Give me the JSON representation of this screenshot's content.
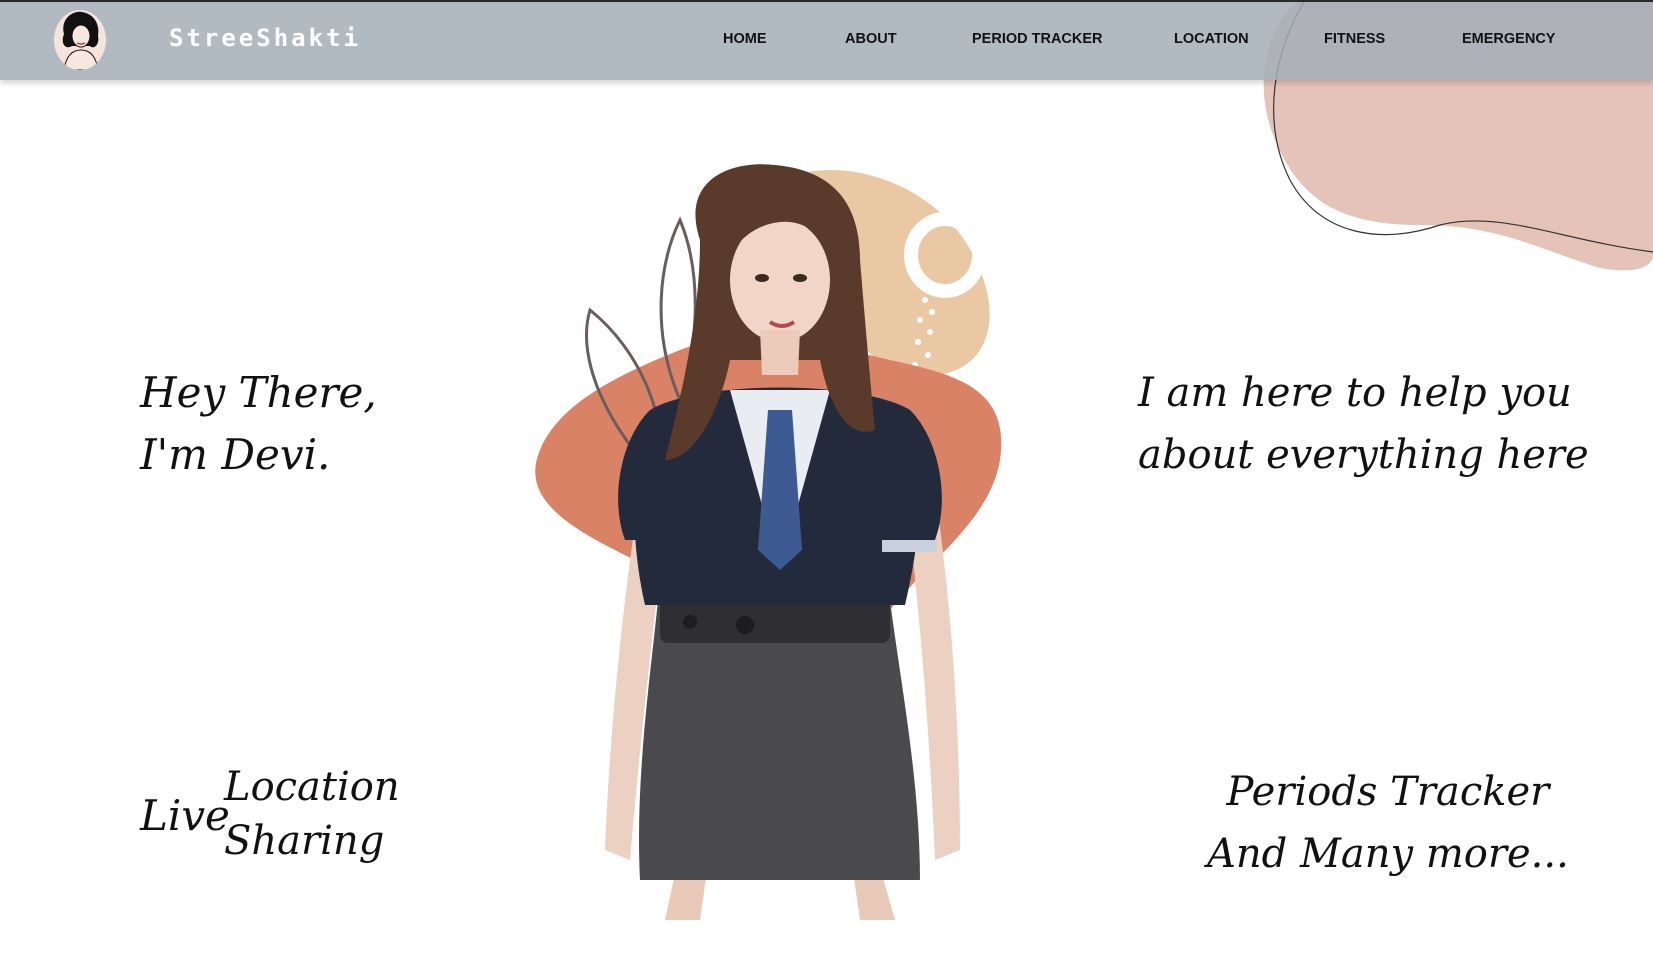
{
  "brand": {
    "name": "StreeShakti",
    "logo_icon": "woman-avatar-icon"
  },
  "nav": {
    "items": [
      {
        "label": "HOME"
      },
      {
        "label": "ABOUT"
      },
      {
        "label": "PERIOD TRACKER"
      },
      {
        "label": "LOCATION"
      },
      {
        "label": "FITNESS"
      },
      {
        "label": "EMERGENCY"
      }
    ]
  },
  "hero": {
    "greeting_line1": "Hey There,",
    "greeting_line2": "I'm Devi.",
    "help_line1": "I am here to help you",
    "help_line2": "about everything here",
    "feature_live": "Live",
    "feature_location_line1": "Location",
    "feature_location_line2": "Sharing",
    "feature_periods_line1": "Periods Tracker",
    "feature_periods_line2": "And Many more..."
  },
  "colors": {
    "navbar": "#a5aeb6",
    "blob_pink": "#e5c3b8",
    "blob_terracotta": "#d98266",
    "blob_peach": "#ebc8a4",
    "text": "#111111"
  }
}
